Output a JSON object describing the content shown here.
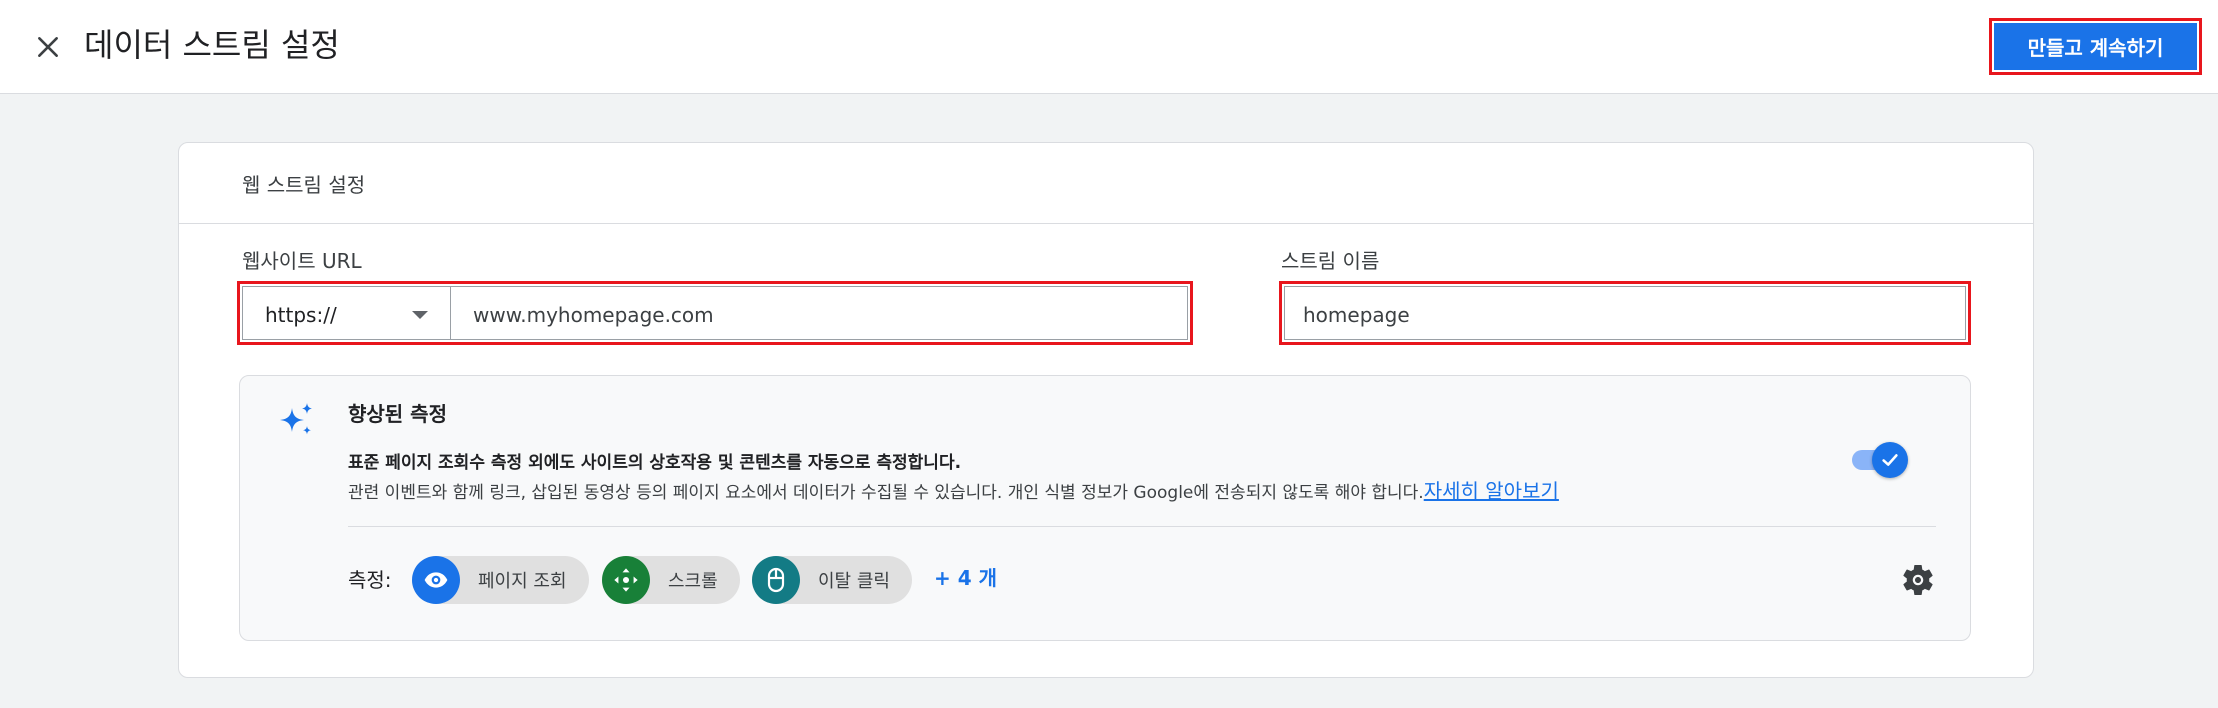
{
  "header": {
    "title": "데이터 스트림 설정",
    "create_button_label": "만들고 계속하기"
  },
  "card": {
    "title": "웹 스트림 설정",
    "website_url": {
      "label": "웹사이트 URL",
      "protocol": "https://",
      "value": "www.myhomepage.com"
    },
    "stream_name": {
      "label": "스트림 이름",
      "value": "homepage"
    },
    "enhanced_measurement": {
      "title": "향상된 측정",
      "description_line1": "표준 페이지 조회수 측정 외에도 사이트의 상호작용 및 콘텐츠를 자동으로 측정합니다.",
      "description_line2": "관련 이벤트와 함께 링크, 삽입된 동영상 등의 페이지 요소에서 데이터가 수집될 수 있습니다. 개인 식별 정보가 Google에 전송되지 않도록 해야 합니다.",
      "learn_more": "자세히 알아보기",
      "enabled": true,
      "chips_label": "측정:",
      "chips": [
        {
          "label": "페이지 조회",
          "icon": "eye-icon",
          "color": "#1a73e8"
        },
        {
          "label": "스크롤",
          "icon": "scroll-arrows-icon",
          "color": "#188038"
        },
        {
          "label": "이탈 클릭",
          "icon": "mouse-icon",
          "color": "#137b85"
        }
      ],
      "more_label": "+ 4 개"
    }
  },
  "colors": {
    "accent": "#1a73e8",
    "highlight": "#e8161d"
  }
}
